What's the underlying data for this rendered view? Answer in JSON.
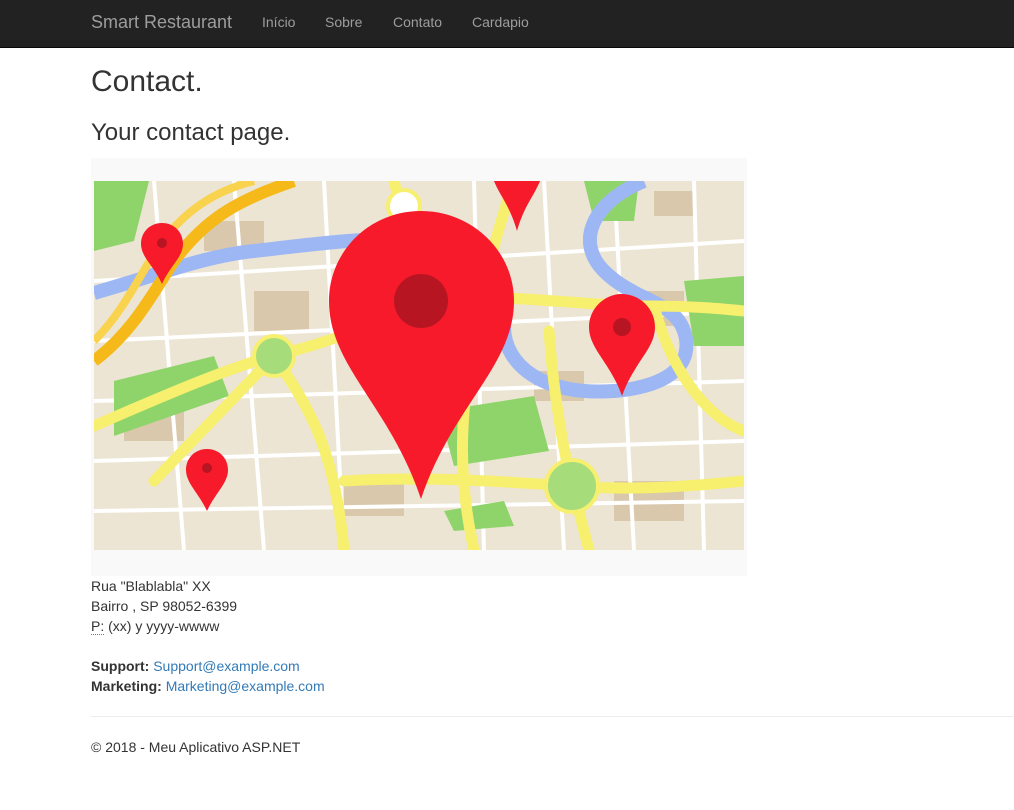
{
  "navbar": {
    "brand": "Smart Restaurant",
    "links": [
      "Início",
      "Sobre",
      "Contato",
      "Cardapio"
    ]
  },
  "page": {
    "title": "Contact.",
    "subtitle": "Your contact page."
  },
  "address": {
    "line1": "Rua \"Blablabla\" XX",
    "line2": "Bairro , SP 98052-6399",
    "phone_label": "P:",
    "phone": "(xx) y yyyy-wwww"
  },
  "contacts": {
    "support_label": "Support:",
    "support_email": "Support@example.com",
    "marketing_label": "Marketing:",
    "marketing_email": "Marketing@example.com"
  },
  "footer": {
    "text": "© 2018 - Meu Aplicativo ASP.NET"
  },
  "colors": {
    "navbar_bg": "#222222",
    "nav_text": "#9d9d9d",
    "link": "#337ab7",
    "pin_red": "#f61a2b"
  }
}
